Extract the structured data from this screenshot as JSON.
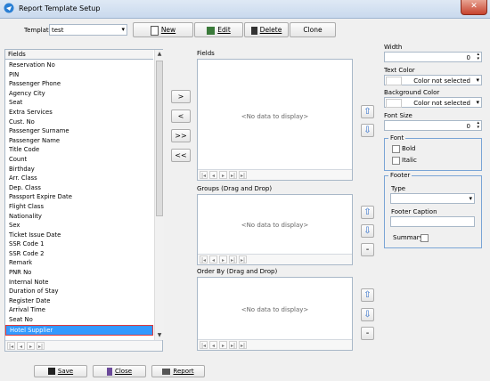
{
  "window": {
    "title": "Report Template Setup",
    "close_label": "✕"
  },
  "toolbar": {
    "template_label": "Template",
    "template_value": "test",
    "new_label": "New",
    "edit_label": "Edit",
    "delete_label": "Delete",
    "clone_label": "Clone"
  },
  "fields_list": {
    "header": "Fields",
    "items": [
      "Reservation No",
      "PIN",
      "Passenger Phone",
      "Agency City",
      "Seat",
      "Extra Services",
      "Cust. No",
      "Passenger Surname",
      "Passenger Name",
      "Title Code",
      "Count",
      "Birthday",
      "Arr. Class",
      "Dep. Class",
      "Passport Expire Date",
      "Flight Class",
      "Nationality",
      "Sex",
      "Ticket Issue Date",
      "SSR Code 1",
      "SSR Code 2",
      "Remark",
      "PNR No",
      "Internal Note",
      "Duration of Stay",
      "Register Date",
      "Arrival Time",
      "Seat No",
      "Hotel Supplier"
    ],
    "selected": "Hotel Supplier"
  },
  "move_buttons": {
    "add": ">",
    "remove": "<",
    "add_all": ">>",
    "remove_all": "<<"
  },
  "panels": {
    "fields_title": "Fields",
    "groups_title": "Groups (Drag and Drop)",
    "orderby_title": "Order By (Drag and Drop)",
    "no_data": "<No data to display>"
  },
  "properties": {
    "width_label": "Width",
    "width_value": "0",
    "text_color_label": "Text Color",
    "text_color_value": "Color not selected",
    "bg_color_label": "Background Color",
    "bg_color_value": "Color not selected",
    "font_size_label": "Font Size",
    "font_size_value": "0",
    "font_group": "Font",
    "bold_label": "Bold",
    "italic_label": "Italic",
    "footer_group": "Footer",
    "type_label": "Type",
    "footer_caption_label": "Footer Caption",
    "summary_label": "Summary"
  },
  "bottom": {
    "save_label": "Save",
    "close_label": "Close",
    "report_label": "Report"
  },
  "colors": {
    "selection": "#3399ff",
    "highlight_border": "#e0383a",
    "arrow_blue": "#2a6ac8"
  }
}
